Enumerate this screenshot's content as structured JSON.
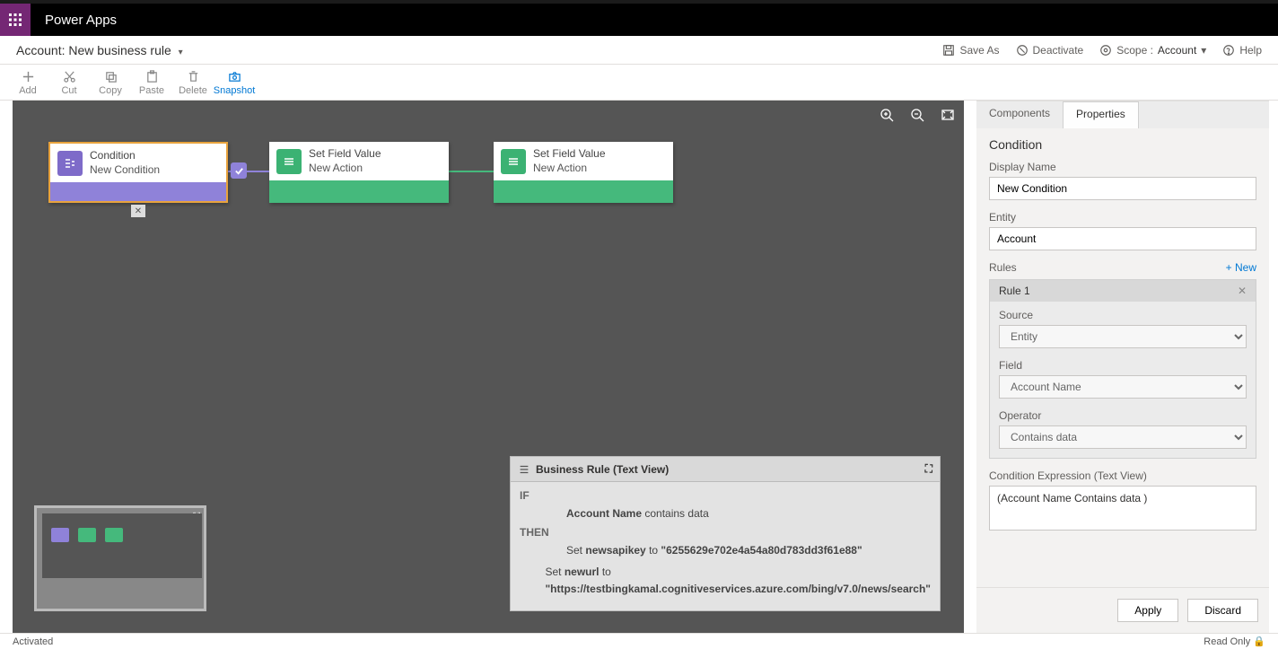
{
  "header": {
    "brand": "Power Apps"
  },
  "breadcrumb": {
    "entity": "Account:",
    "rule": "New business rule"
  },
  "top_actions": {
    "save_as": "Save As",
    "deactivate": "Deactivate",
    "scope_label": "Scope :",
    "scope_value": "Account",
    "help": "Help"
  },
  "toolbar": {
    "add": "Add",
    "cut": "Cut",
    "copy": "Copy",
    "paste": "Paste",
    "delete": "Delete",
    "snapshot": "Snapshot"
  },
  "nodes": {
    "condition": {
      "title": "Condition",
      "subtitle": "New Condition"
    },
    "action1": {
      "title": "Set Field Value",
      "subtitle": "New Action"
    },
    "action2": {
      "title": "Set Field Value",
      "subtitle": "New Action"
    }
  },
  "text_view": {
    "title": "Business Rule (Text View)",
    "if": "IF",
    "then": "THEN",
    "cond_field": "Account Name",
    "cond_tail": " contains data",
    "set_pre": "Set ",
    "set1_field": "newsapikey",
    "set_mid": " to ",
    "set1_value": "\"6255629e702e4a54a80d783dd3f61e88\"",
    "set2_field": "newurl",
    "set2_value": "\"https://testbingkamal.cognitiveservices.azure.com/bing/v7.0/news/search\""
  },
  "panel": {
    "tabs": {
      "components": "Components",
      "properties": "Properties"
    },
    "section_title": "Condition",
    "display_name_label": "Display Name",
    "display_name_value": "New Condition",
    "entity_label": "Entity",
    "entity_value": "Account",
    "rules_label": "Rules",
    "new_link": "+ New",
    "rule_title": "Rule 1",
    "source_label": "Source",
    "source_value": "Entity",
    "field_label": "Field",
    "field_value": "Account Name",
    "operator_label": "Operator",
    "operator_value": "Contains data",
    "expr_label": "Condition Expression (Text View)",
    "expr_value": "(Account Name Contains data )",
    "apply": "Apply",
    "discard": "Discard"
  },
  "status": {
    "left": "Activated",
    "right": "Read Only 🔒"
  }
}
